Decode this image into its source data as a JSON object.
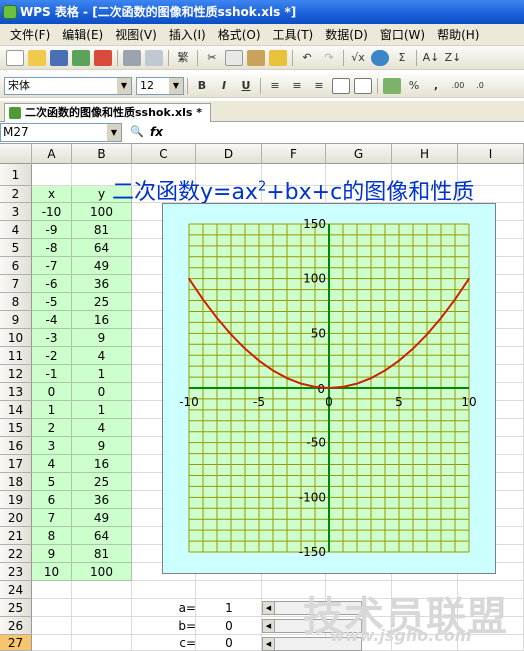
{
  "window": {
    "title": "WPS 表格 - [二次函数的图像和性质sshok.xls *]"
  },
  "menu": [
    "文件(F)",
    "编辑(E)",
    "视图(V)",
    "插入(I)",
    "格式(O)",
    "工具(T)",
    "数据(D)",
    "窗口(W)",
    "帮助(H)"
  ],
  "font": {
    "name": "宋体",
    "size": "12"
  },
  "tab": {
    "label": "二次函数的图像和性质sshok.xls *"
  },
  "formula_bar": {
    "name_box": "M27",
    "fx": "fx"
  },
  "columns": [
    "A",
    "B",
    "C",
    "D",
    "F",
    "G",
    "H",
    "I"
  ],
  "rows": [
    "1",
    "2",
    "3",
    "4",
    "5",
    "6",
    "7",
    "8",
    "9",
    "10",
    "11",
    "12",
    "13",
    "14",
    "15",
    "16",
    "17",
    "18",
    "19",
    "20",
    "21",
    "22",
    "23",
    "24",
    "25",
    "26",
    "27"
  ],
  "selected_row": "27",
  "sheet_title": {
    "main": "二次函数y=ax",
    "sup": "2",
    "rest": "+bx+c的图像和性质"
  },
  "table": {
    "headers": [
      "x",
      "y"
    ],
    "x": [
      "-10",
      "-9",
      "-8",
      "-7",
      "-6",
      "-5",
      "-4",
      "-3",
      "-2",
      "-1",
      "0",
      "1",
      "2",
      "3",
      "4",
      "5",
      "6",
      "7",
      "8",
      "9",
      "10"
    ],
    "y": [
      "100",
      "81",
      "64",
      "49",
      "36",
      "25",
      "16",
      "9",
      "4",
      "1",
      "0",
      "1",
      "4",
      "9",
      "16",
      "25",
      "36",
      "49",
      "64",
      "81",
      "100"
    ]
  },
  "params": [
    {
      "label": "a=",
      "value": "1"
    },
    {
      "label": "b=",
      "value": "0"
    },
    {
      "label": "c=",
      "value": "0"
    }
  ],
  "watermark": {
    "main": "技术员联盟",
    "url": "www.jsgho.com"
  },
  "chart_data": {
    "type": "line",
    "x": [
      -10,
      -9,
      -8,
      -7,
      -6,
      -5,
      -4,
      -3,
      -2,
      -1,
      0,
      1,
      2,
      3,
      4,
      5,
      6,
      7,
      8,
      9,
      10
    ],
    "series": [
      {
        "values": [
          100,
          81,
          64,
          49,
          36,
          25,
          16,
          9,
          4,
          1,
          0,
          1,
          4,
          9,
          16,
          25,
          36,
          49,
          64,
          81,
          100
        ],
        "color": "#cc2200"
      }
    ],
    "xlim": [
      -10,
      10
    ],
    "ylim": [
      -150,
      150
    ],
    "xticks": [
      "-10",
      "-5",
      "0",
      "5",
      "10"
    ],
    "yticks": [
      "150",
      "100",
      "50",
      "0",
      "-50",
      "-100",
      "-150"
    ],
    "grid": true,
    "grid_color": "#999900",
    "axis_color": "#008800",
    "plot_bg": "#ccffcc",
    "chart_bg": "#ccffff"
  }
}
